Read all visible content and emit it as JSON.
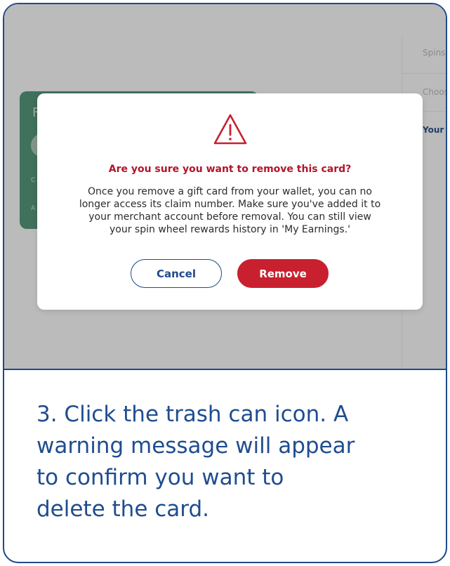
{
  "background": {
    "side_panel": {
      "items": [
        "Spins",
        "Choos",
        "Your C"
      ]
    },
    "gift_card": {
      "letter": "F",
      "small_text_1": "C",
      "small_text_2": "A"
    }
  },
  "dialog": {
    "icon": "warning-triangle-icon",
    "title": "Are you sure you want to remove this card?",
    "body_lines": [
      "Once you remove a gift card from your wallet, you can no",
      "longer access its claim number. Make sure you've added it to",
      "your merchant account before removal. You can still view",
      "your spin wheel rewards history in 'My Earnings.'"
    ],
    "cancel_label": "Cancel",
    "remove_label": "Remove"
  },
  "caption": {
    "lines": [
      "3. Click the trash can icon. A",
      "warning message will appear",
      "to confirm you want to",
      "delete the card."
    ]
  },
  "colors": {
    "frame_border": "#1e4a8a",
    "warning_red": "#c8202f",
    "title_red": "#b3142a",
    "caption_blue": "#1f4d8f",
    "card_green": "#3f7a62"
  }
}
